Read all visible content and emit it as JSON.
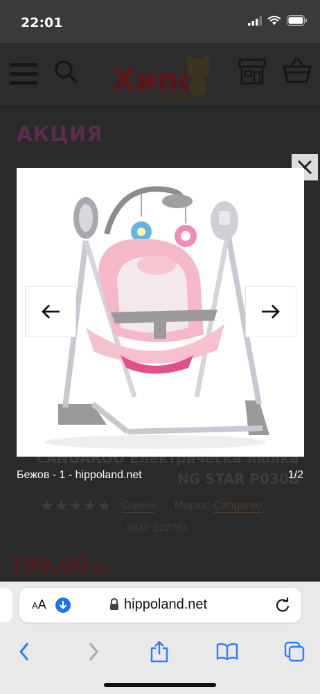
{
  "status_bar": {
    "time": "22:01"
  },
  "header": {
    "menu_icon": "menu-icon",
    "search_icon": "search-icon",
    "logo_text": "Хипо Land",
    "store_icon": "store-icon",
    "cart_icon": "basket-icon"
  },
  "product": {
    "promo_badge": "АКЦИЯ",
    "title_line1": "CANGAROO Електрическа люлка",
    "title_line2": "NG STAR P030B",
    "rate_link": "Оцени",
    "brand_label": "Марка:",
    "brand": "Cangaroo",
    "sku": "SKU: 102761",
    "price": "199,00",
    "currency": "лв."
  },
  "lightbox": {
    "caption": "Бежов - 1 - hippoland.net",
    "counter": "1/2",
    "image_subject": "pink baby swing",
    "close_icon": "close-icon",
    "prev_icon": "arrow-left-icon",
    "next_icon": "arrow-right-icon"
  },
  "browser": {
    "aa_small": "A",
    "aa_large": "A",
    "url": "hippoland.net",
    "toolbar_icons": [
      "back-icon",
      "forward-icon",
      "share-icon",
      "bookmarks-icon",
      "tabs-icon"
    ]
  },
  "colors": {
    "overlay": "#1b1b1b",
    "toolbar": "#e9e9ea",
    "accent_blue": "#1a73e8",
    "swing_pink": "#f4b8c8"
  }
}
